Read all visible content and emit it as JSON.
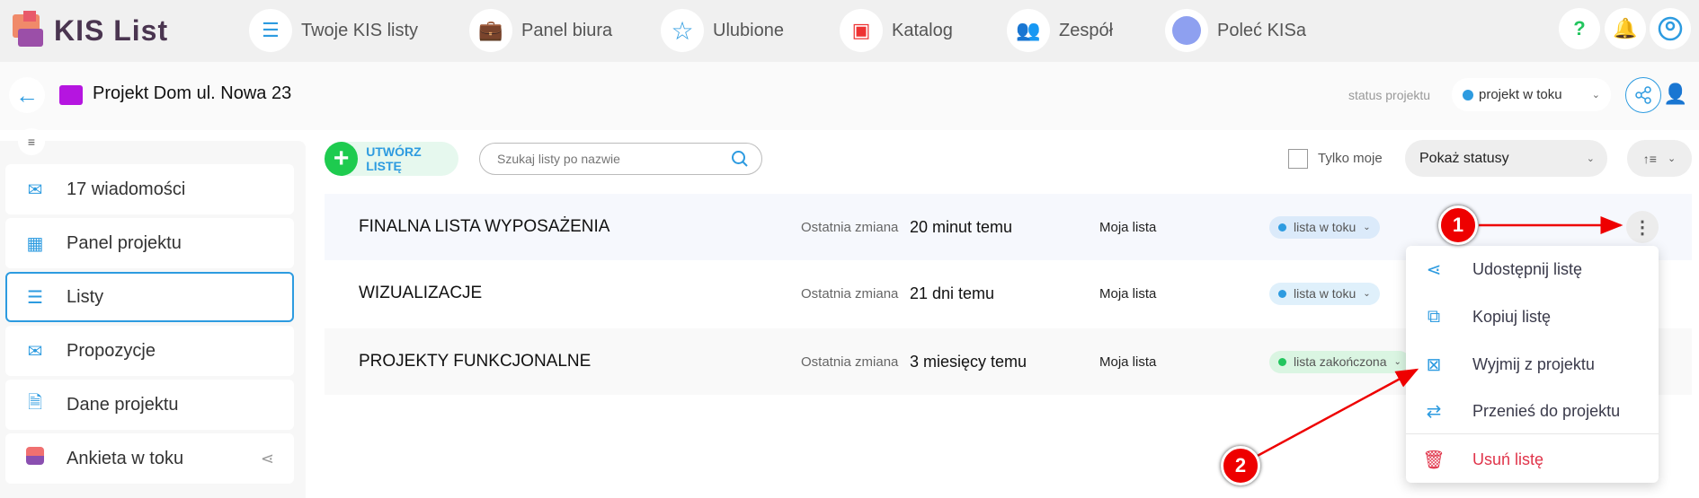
{
  "app": {
    "logo_text": "KIS List"
  },
  "nav": [
    {
      "label": "Twoje KIS listy",
      "icon": "list-icon"
    },
    {
      "label": "Panel biura",
      "icon": "briefcase-icon"
    },
    {
      "label": "Ulubione",
      "icon": "star-icon"
    },
    {
      "label": "Katalog",
      "icon": "3d-box-icon"
    },
    {
      "label": "Zespół",
      "icon": "team-icon"
    },
    {
      "label": "Poleć KISa",
      "icon": "emoji-kiss-icon"
    }
  ],
  "header": {
    "project_title": "Projekt Dom ul. Nowa 23",
    "status_label": "status projektu",
    "status_value": "projekt w toku"
  },
  "sidebar": {
    "items": [
      {
        "label": "17 wiadomości",
        "icon": "mail-icon"
      },
      {
        "label": "Panel projektu",
        "icon": "grid-icon"
      },
      {
        "label": "Listy",
        "icon": "list-icon",
        "selected": true
      },
      {
        "label": "Propozycje",
        "icon": "send-mail-icon"
      },
      {
        "label": "Dane projektu",
        "icon": "document-icon"
      },
      {
        "label": "Ankieta w toku",
        "icon": "robot-icon"
      }
    ]
  },
  "toolbar": {
    "create_label": "UTWÓRZ LISTĘ",
    "search_placeholder": "Szukaj listy po nazwie",
    "only_mine_label": "Tylko moje",
    "only_mine_checked": false,
    "status_filter": "Pokaż statusy"
  },
  "lists": [
    {
      "name": "FINALNA LISTA WYPOSAŻENIA",
      "changed_label": "Ostatnia zmiana",
      "changed": "20 minut temu",
      "owner": "Moja lista",
      "status": "lista w toku",
      "status_color": "#2d9be0"
    },
    {
      "name": "WIZUALIZACJE",
      "changed_label": "Ostatnia zmiana",
      "changed": "21 dni temu",
      "owner": "Moja lista",
      "status": "lista w toku",
      "status_color": "#2d9be0"
    },
    {
      "name": "PROJEKTY FUNKCJONALNE",
      "changed_label": "Ostatnia zmiana",
      "changed": "3 miesięcy temu",
      "owner": "Moja lista",
      "status": "lista zakończona",
      "status_color": "#22c55e"
    }
  ],
  "context_menu": {
    "items": [
      {
        "label": "Udostępnij listę",
        "icon": "share-icon"
      },
      {
        "label": "Kopiuj listę",
        "icon": "copy-icon"
      },
      {
        "label": "Wyjmij z projektu",
        "icon": "folder-remove-icon"
      },
      {
        "label": "Przenieś do projektu",
        "icon": "transfer-icon"
      },
      {
        "label": "Usuń listę",
        "icon": "trash-icon",
        "danger": true
      }
    ]
  },
  "annotations": {
    "one": "1",
    "two": "2"
  },
  "colors": {
    "accent": "#2d9be0",
    "danger": "#e0344a",
    "success": "#22c55e"
  }
}
